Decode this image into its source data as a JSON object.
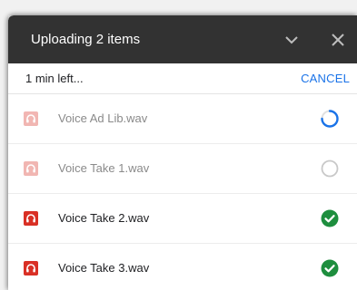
{
  "header": {
    "title": "Uploading 2 items"
  },
  "status": {
    "time_left": "1 min left...",
    "cancel_label": "CANCEL"
  },
  "files": [
    {
      "name": "Voice Ad Lib.wav",
      "state": "uploading",
      "icon": "audio-file-icon",
      "progress": 0.75
    },
    {
      "name": "Voice Take 1.wav",
      "state": "queued",
      "icon": "audio-file-icon"
    },
    {
      "name": "Voice Take 2.wav",
      "state": "complete",
      "icon": "audio-file-icon"
    },
    {
      "name": "Voice Take 3.wav",
      "state": "complete",
      "icon": "audio-file-icon"
    }
  ],
  "colors": {
    "header_bg": "#323232",
    "accent": "#1a73e8",
    "audio_icon": "#d93025",
    "complete": "#1e8e3e",
    "queued_ring": "#c8c8c8"
  }
}
